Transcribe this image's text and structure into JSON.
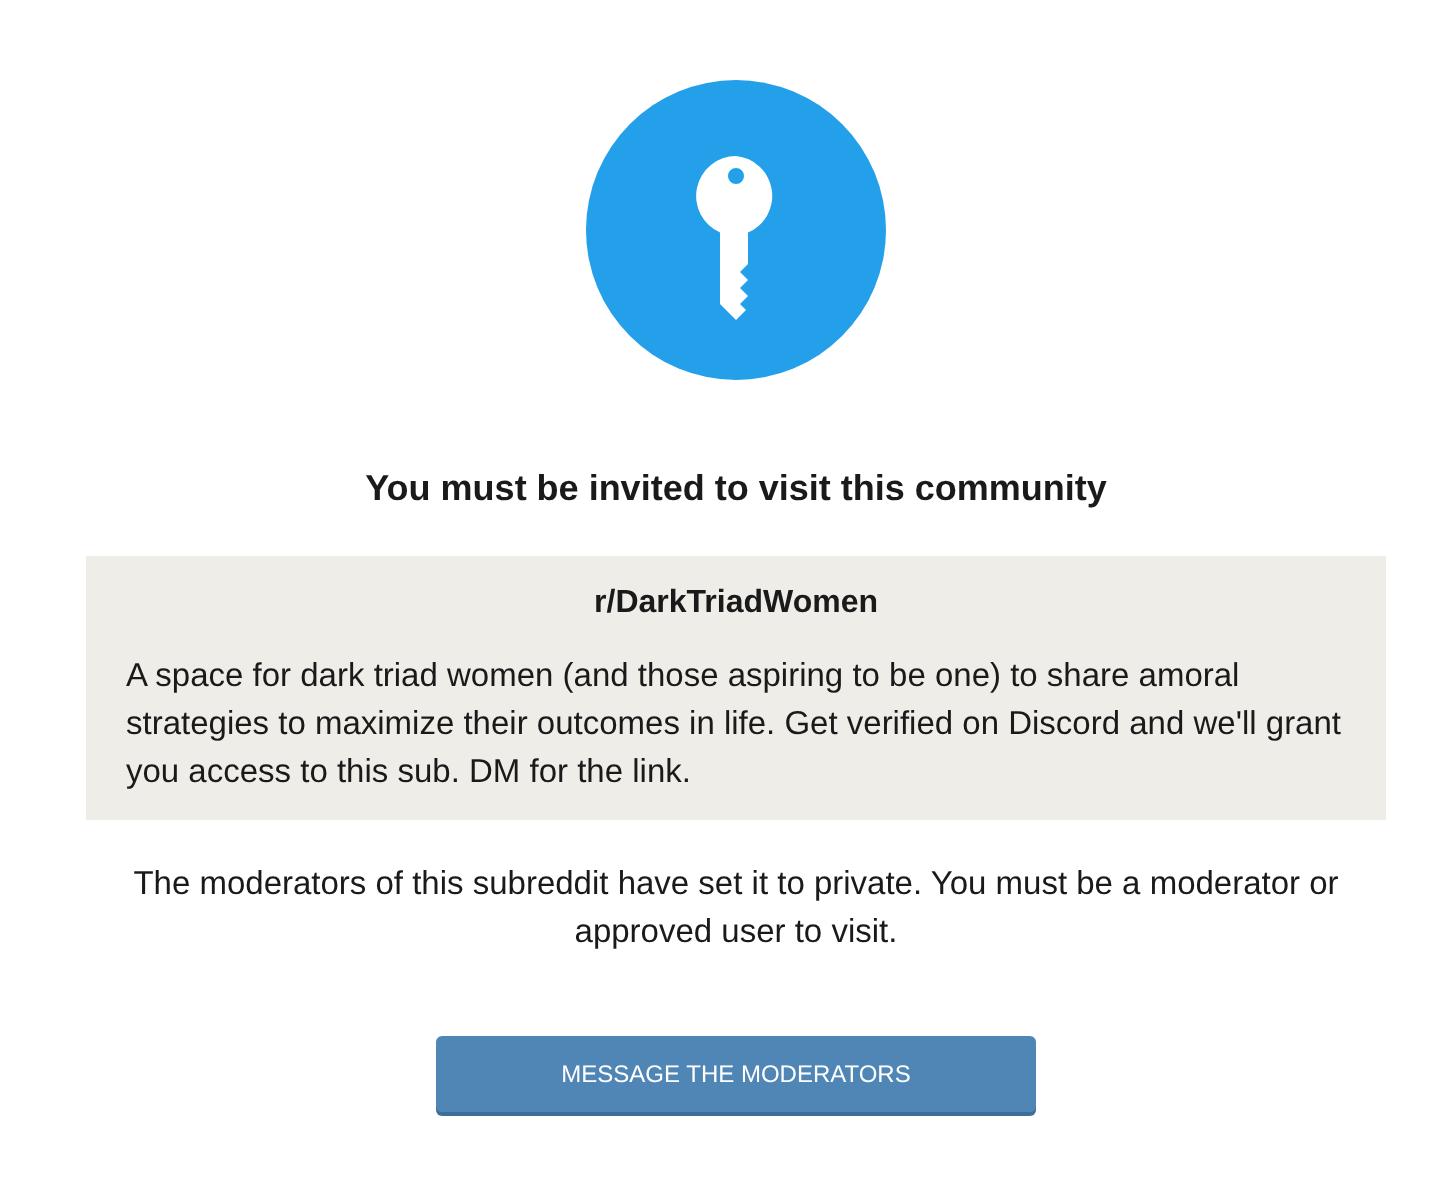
{
  "heading": "You must be invited to visit this community",
  "community": {
    "name": "r/DarkTriadWomen",
    "description": "A space for dark triad women (and those aspiring to be one) to share amoral strategies to maximize their outcomes in life. Get verified on Discord and we'll grant you access to this sub. DM for the link."
  },
  "notice": "The moderators of this subreddit have set it to private. You must be a moderator or approved user to visit.",
  "button": "MESSAGE THE MODERATORS"
}
